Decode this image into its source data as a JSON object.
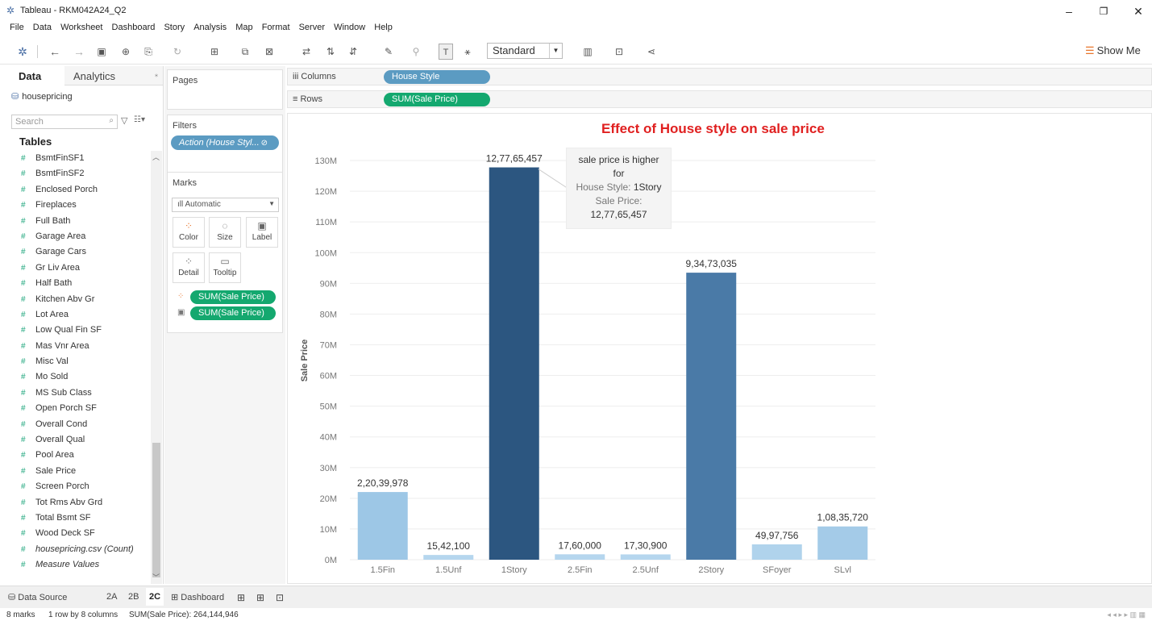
{
  "window": {
    "title": "Tableau - RKM042A24_Q2",
    "minimize": "–",
    "maximize": "❐",
    "close": "✕"
  },
  "menu": [
    "File",
    "Data",
    "Worksheet",
    "Dashboard",
    "Story",
    "Analysis",
    "Map",
    "Format",
    "Server",
    "Window",
    "Help"
  ],
  "toolbar": {
    "fit_select": "Standard",
    "show_me": "Show Me"
  },
  "data_pane": {
    "tab_data": "Data",
    "tab_analytics": "Analytics",
    "datasource": "housepricing",
    "search_placeholder": "Search",
    "tables_heading": "Tables",
    "fields": [
      {
        "name": "BsmtFinSF1",
        "italic": false
      },
      {
        "name": "BsmtFinSF2",
        "italic": false
      },
      {
        "name": "Enclosed Porch",
        "italic": false
      },
      {
        "name": "Fireplaces",
        "italic": false
      },
      {
        "name": "Full Bath",
        "italic": false
      },
      {
        "name": "Garage Area",
        "italic": false
      },
      {
        "name": "Garage Cars",
        "italic": false
      },
      {
        "name": "Gr Liv Area",
        "italic": false
      },
      {
        "name": "Half Bath",
        "italic": false
      },
      {
        "name": "Kitchen Abv Gr",
        "italic": false
      },
      {
        "name": "Lot Area",
        "italic": false
      },
      {
        "name": "Low Qual Fin SF",
        "italic": false
      },
      {
        "name": "Mas Vnr Area",
        "italic": false
      },
      {
        "name": "Misc Val",
        "italic": false
      },
      {
        "name": "Mo Sold",
        "italic": false
      },
      {
        "name": "MS Sub Class",
        "italic": false
      },
      {
        "name": "Open Porch SF",
        "italic": false
      },
      {
        "name": "Overall Cond",
        "italic": false
      },
      {
        "name": "Overall Qual",
        "italic": false
      },
      {
        "name": "Pool Area",
        "italic": false
      },
      {
        "name": "Sale Price",
        "italic": false
      },
      {
        "name": "Screen Porch",
        "italic": false
      },
      {
        "name": "Tot Rms Abv Grd",
        "italic": false
      },
      {
        "name": "Total Bsmt SF",
        "italic": false
      },
      {
        "name": "Wood Deck SF",
        "italic": false
      },
      {
        "name": "housepricing.csv (Count)",
        "italic": true
      },
      {
        "name": "Measure Values",
        "italic": true
      }
    ]
  },
  "cards": {
    "pages_label": "Pages",
    "filters_label": "Filters",
    "filter_pill": "Action (House Styl...",
    "marks_label": "Marks",
    "marks_type": "Automatic",
    "mark_buttons": [
      "Color",
      "Size",
      "Label",
      "Detail",
      "Tooltip"
    ],
    "mark_pills": [
      "SUM(Sale Price)",
      "SUM(Sale Price)"
    ]
  },
  "shelves": {
    "columns_label": "Columns",
    "rows_label": "Rows",
    "columns_pill": "House Style",
    "rows_pill": "SUM(Sale Price)"
  },
  "chart_data": {
    "type": "bar",
    "title": "Effect of House style on sale price",
    "xlabel": "",
    "ylabel": "Sale Price",
    "categories": [
      "1.5Fin",
      "1.5Unf",
      "1Story",
      "2.5Fin",
      "2.5Unf",
      "2Story",
      "SFoyer",
      "SLvl"
    ],
    "values": [
      22039978,
      1542100,
      127765457,
      1760000,
      1730900,
      93473035,
      4997756,
      10835720
    ],
    "value_labels": [
      "2,20,39,978",
      "15,42,100",
      "12,77,65,457",
      "17,60,000",
      "17,30,900",
      "9,34,73,035",
      "49,97,756",
      "1,08,35,720"
    ],
    "colors": [
      "#9dc7e6",
      "#b5d6ee",
      "#2c5680",
      "#b5d6ee",
      "#b5d6ee",
      "#4a7aa7",
      "#b0d3ec",
      "#a4cbe8"
    ],
    "ylim": [
      0,
      135000000
    ],
    "yticks": [
      0,
      10000000,
      20000000,
      30000000,
      40000000,
      50000000,
      60000000,
      70000000,
      80000000,
      90000000,
      100000000,
      110000000,
      120000000,
      130000000
    ],
    "ytick_labels": [
      "0M",
      "10M",
      "20M",
      "30M",
      "40M",
      "50M",
      "60M",
      "70M",
      "80M",
      "90M",
      "100M",
      "110M",
      "120M",
      "130M"
    ],
    "grid": true
  },
  "tooltip": {
    "line1": "sale price is higher",
    "line2": "for",
    "line3_prefix": "House Style: ",
    "line3_value": "1Story",
    "line4": "Sale Price:",
    "line5": "12,77,65,457"
  },
  "bottom_tabs": {
    "data_source": "Data Source",
    "sheets": [
      "2A",
      "2B",
      "2C"
    ],
    "active_sheet": "2C",
    "dashboard": "Dashboard"
  },
  "status": {
    "marks": "8 marks",
    "dims": "1 row by 8 columns",
    "sum": "SUM(Sale Price): 264,144,946"
  }
}
